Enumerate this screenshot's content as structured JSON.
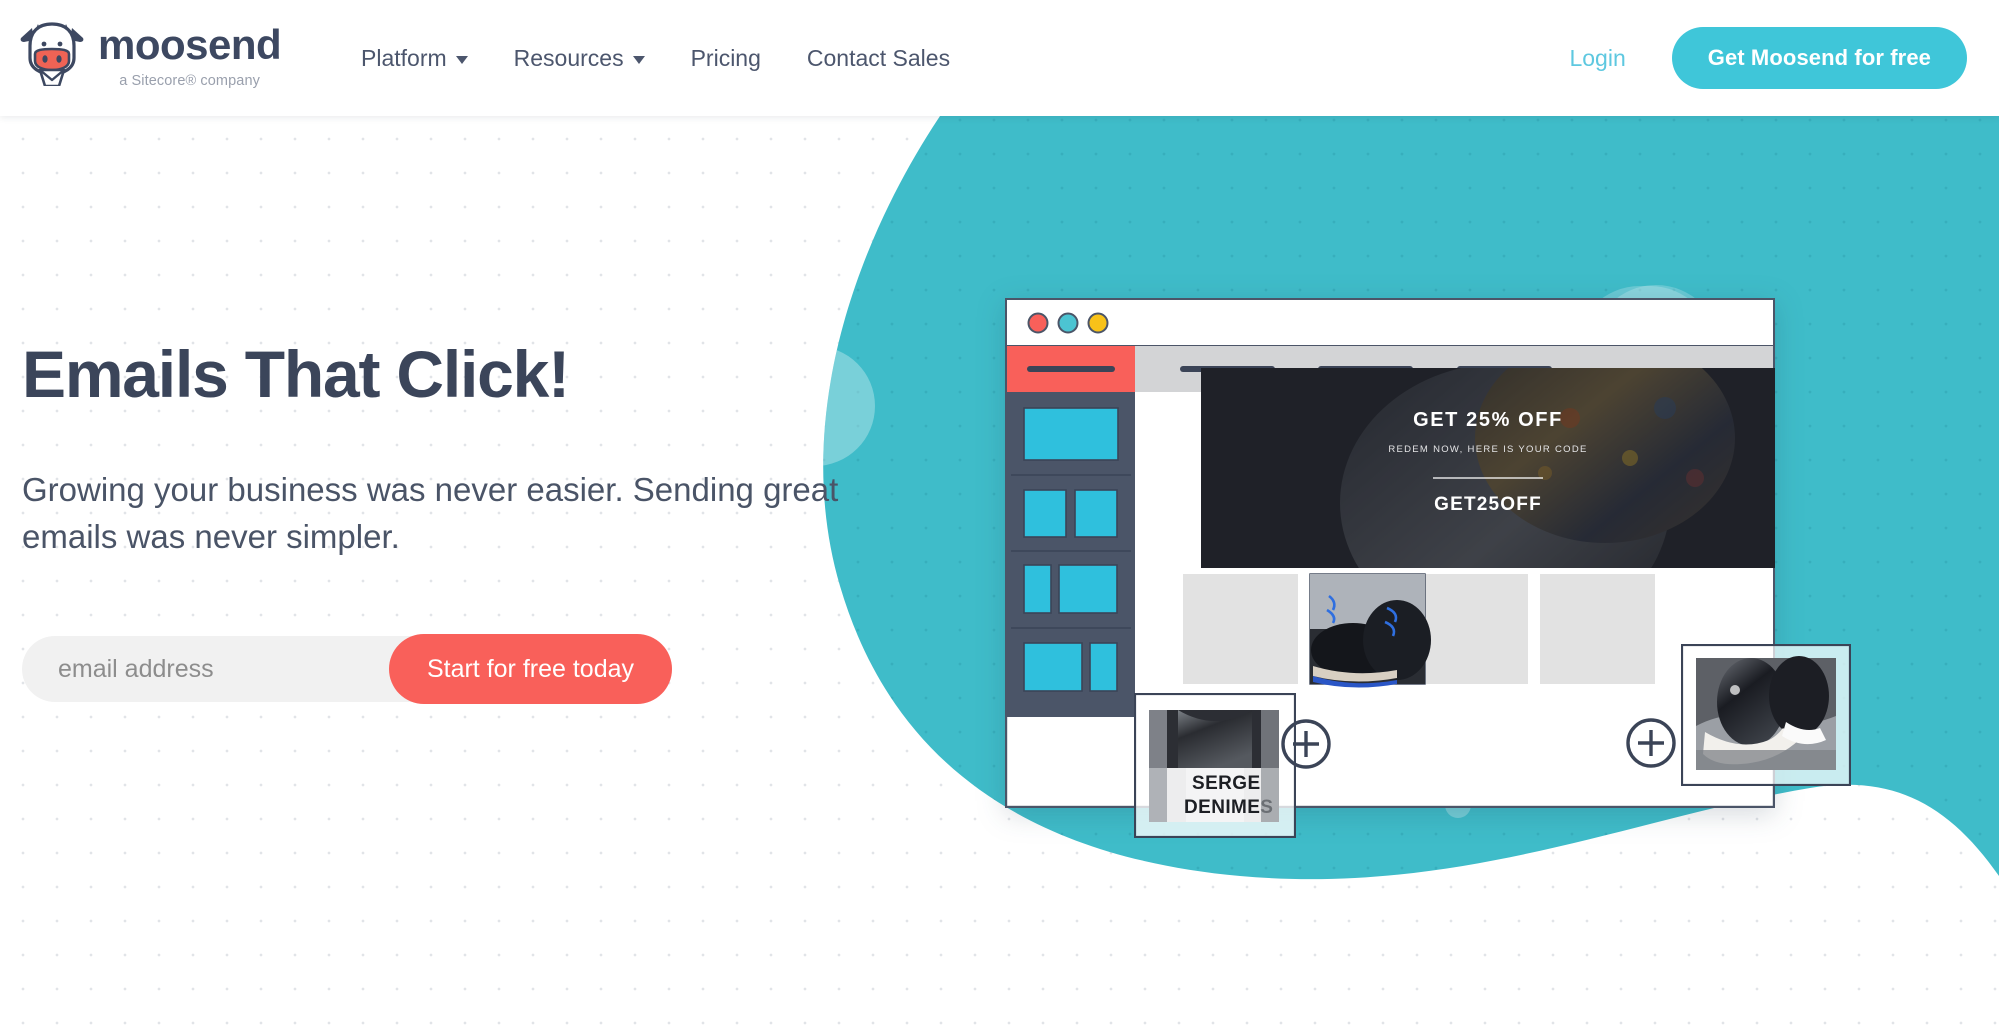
{
  "brand": {
    "name": "moosend",
    "tagline": "a Sitecore® company",
    "logo_icon": "cow-head-envelope-logo",
    "colors": {
      "teal": "#3fc6d9",
      "blob_teal": "#3fbcc9",
      "coral": "#f9605a",
      "navy": "#3b455a",
      "login_blue": "#5ec8e0",
      "panel_navy": "#4b5568",
      "block_cyan": "#2fc0dd"
    }
  },
  "header": {
    "nav": [
      {
        "label": "Platform",
        "has_dropdown": true,
        "caret_icon": "chevron-down-icon"
      },
      {
        "label": "Resources",
        "has_dropdown": true,
        "caret_icon": "chevron-down-icon"
      },
      {
        "label": "Pricing",
        "has_dropdown": false
      },
      {
        "label": "Contact Sales",
        "has_dropdown": false
      }
    ],
    "login_label": "Login",
    "cta_label": "Get Moosend for free"
  },
  "hero": {
    "title": "Emails That Click!",
    "subtitle": "Growing your business was never easier. Sending great emails was never simpler.",
    "form": {
      "email_placeholder": "email address",
      "email_value": "",
      "submit_label": "Start for free today"
    }
  },
  "mockup": {
    "browser_dots": [
      {
        "name": "close-dot",
        "color": "#f9605a"
      },
      {
        "name": "minimize-dot",
        "color": "#4cc4d2"
      },
      {
        "name": "maximize-dot",
        "color": "#f8c219"
      }
    ],
    "toolbar_placeholders": 3,
    "sidebar_blocks": [
      {
        "layout": "full"
      },
      {
        "layout": "two-equal"
      },
      {
        "layout": "narrow-wide"
      },
      {
        "layout": "wide-narrow"
      }
    ],
    "email_banner": {
      "headline": "GET 25% OFF",
      "subline": "REDEM NOW, HERE IS YOUR CODE",
      "code": "GET25OFF"
    },
    "product_images": [
      {
        "name": "tshirt-serge-denimes",
        "caption_line1": "SERGE",
        "caption_line2": "DENIMES"
      },
      {
        "name": "dress-shoes-photo"
      },
      {
        "name": "sneakers-photo"
      }
    ],
    "drop_targets": [
      {
        "name": "add-image-plus-left",
        "icon": "plus-circle-icon"
      },
      {
        "name": "add-image-plus-right",
        "icon": "plus-circle-icon"
      }
    ]
  }
}
